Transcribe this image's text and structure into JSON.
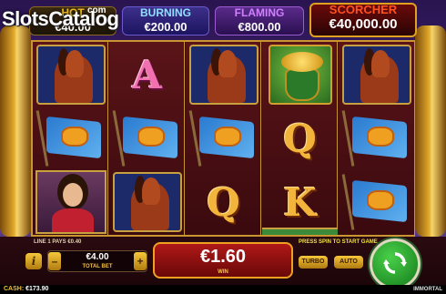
{
  "watermark": {
    "brand": "SlotsCatalog",
    "suffix": "com"
  },
  "jackpots": [
    {
      "name": "HOT",
      "amount": "€40.00"
    },
    {
      "name": "BURNING",
      "amount": "€200.00"
    },
    {
      "name": "FLAMING",
      "amount": "€800.00"
    },
    {
      "name": "SCORCHER",
      "amount": "€40,000.00"
    }
  ],
  "reels": [
    [
      "horse",
      "flag",
      "woman"
    ],
    [
      "A",
      "flag",
      "horse"
    ],
    [
      "horse",
      "flag",
      "Q"
    ],
    [
      "pot",
      "Q",
      "K"
    ],
    [
      "horse",
      "flag",
      "flag"
    ]
  ],
  "panel": {
    "line_pays": "LINE 1 PAYS €0.40",
    "press_spin": "PRESS SPIN TO START GAME",
    "info": "i",
    "minus": "–",
    "plus": "+",
    "bet_amount": "€4.00",
    "bet_label": "TOTAL BET",
    "win_amount": "€1.60",
    "win_label": "WIN",
    "turbo": "TURBO",
    "auto": "AUTO"
  },
  "footer": {
    "cash_label": "CASH:",
    "cash_value": "€173.90",
    "game_title": "IMMORTAL"
  },
  "colors": {
    "spin": "#2aa02a",
    "win_box": "#a01010",
    "accent_gold": "#f0b030"
  }
}
